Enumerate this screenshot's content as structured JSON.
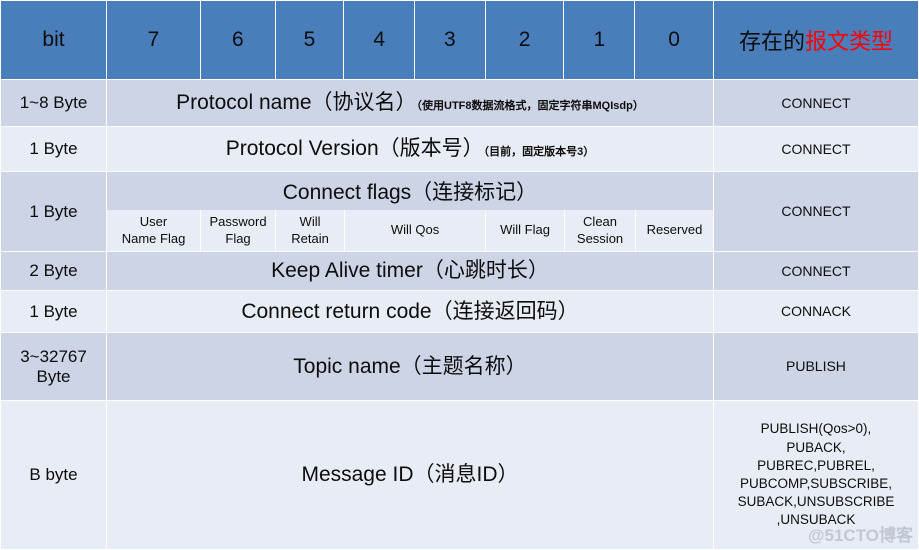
{
  "header": {
    "bit_label": "bit",
    "bits": [
      "7",
      "6",
      "5",
      "4",
      "3",
      "2",
      "1",
      "0"
    ],
    "type_prefix": "存在的",
    "type_highlight": "报文类型",
    "highlight_color": "#ff0000",
    "bg_color": "#4a7ebb",
    "text_color": "#ffffff"
  },
  "rows": [
    {
      "size": "1~8 Byte",
      "field": "Protocol name（协议名）",
      "note": "（使用UTF8数据流格式，固定字符串MQIsdp）",
      "message": "CONNECT"
    },
    {
      "size": "1 Byte",
      "field": "Protocol Version（版本号）",
      "note": "（目前，固定版本号3）",
      "message": "CONNECT"
    },
    {
      "size": "1 Byte",
      "field": "Connect flags（连接标记）",
      "note": "",
      "message": "CONNECT",
      "flags": [
        "User\nName Flag",
        "Password\nFlag",
        "Will\nRetain",
        "Will Qos",
        "Will Flag",
        "Clean\nSession",
        "Reserved"
      ]
    },
    {
      "size": "2 Byte",
      "field": "Keep Alive timer（心跳时长）",
      "note": "",
      "message": "CONNECT"
    },
    {
      "size": "1 Byte",
      "field": "Connect return code（连接返回码）",
      "note": "",
      "message": "CONNACK"
    },
    {
      "size": "3~32767 Byte",
      "field": "Topic name（主题名称）",
      "note": "",
      "message": "PUBLISH"
    },
    {
      "size": "B byte",
      "field": "Message ID（消息ID）",
      "note": "",
      "message": "PUBLISH(Qos>0),\nPUBACK,\nPUBREC,PUBREL,\nPUBCOMP,SUBSCRIBE,\nSUBACK,UNSUBSCRIBE\n,UNSUBACK"
    }
  ],
  "watermark": "@51CTO博客"
}
